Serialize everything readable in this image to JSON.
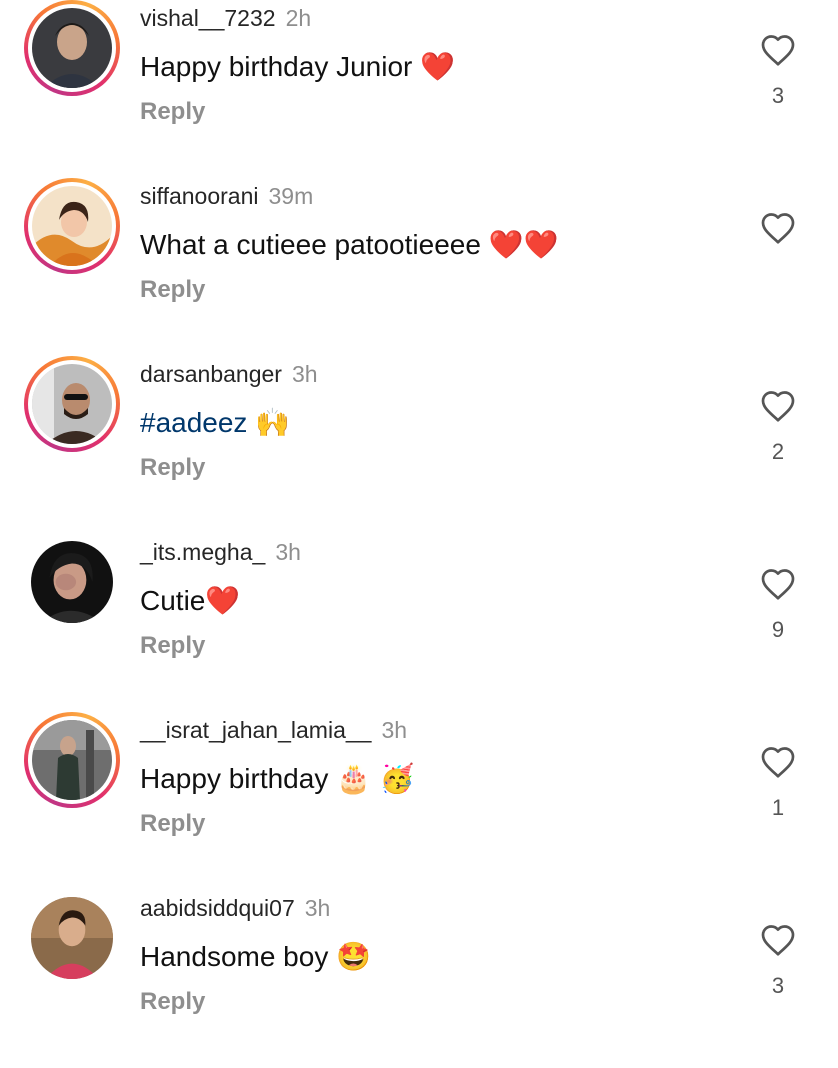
{
  "comments": [
    {
      "username": "vishal__7232",
      "time": "2h",
      "text": "Happy birthday Junior",
      "emoji": "❤️",
      "reply_label": "Reply",
      "likes": "3",
      "story_ring": true,
      "avatar_colors": [
        "#3a3b3f",
        "#c9a48a"
      ]
    },
    {
      "username": "siffanoorani",
      "time": "39m",
      "text": "What a cutieee patootieeee",
      "emoji": "❤️❤️",
      "reply_label": "Reply",
      "likes": "",
      "story_ring": true,
      "avatar_colors": [
        "#e08a2c",
        "#f2c6a8"
      ]
    },
    {
      "username": "darsanbanger",
      "time": "3h",
      "hashtag": "#aadeez",
      "emoji": "🙌",
      "reply_label": "Reply",
      "likes": "2",
      "story_ring": true,
      "avatar_colors": [
        "#bdbdbd",
        "#3a2a22"
      ]
    },
    {
      "username": "_its.megha_",
      "time": "3h",
      "text": "Cutie",
      "emoji": "❤️",
      "reply_label": "Reply",
      "likes": "9",
      "story_ring": false,
      "avatar_colors": [
        "#111111",
        "#c99a86"
      ]
    },
    {
      "username": "__israt_jahan_lamia__",
      "time": "3h",
      "text": "Happy birthday",
      "emoji": "🎂 🥳",
      "reply_label": "Reply",
      "likes": "1",
      "story_ring": true,
      "avatar_colors": [
        "#6e6e6e",
        "#2d3a33"
      ]
    },
    {
      "username": "aabidsiddqui07",
      "time": "3h",
      "text": "Handsome boy",
      "emoji": "🤩",
      "reply_label": "Reply",
      "likes": "3",
      "story_ring": false,
      "avatar_colors": [
        "#8a6a4a",
        "#d63e5e"
      ]
    }
  ],
  "icons": {
    "like": "heart-outline-icon"
  }
}
